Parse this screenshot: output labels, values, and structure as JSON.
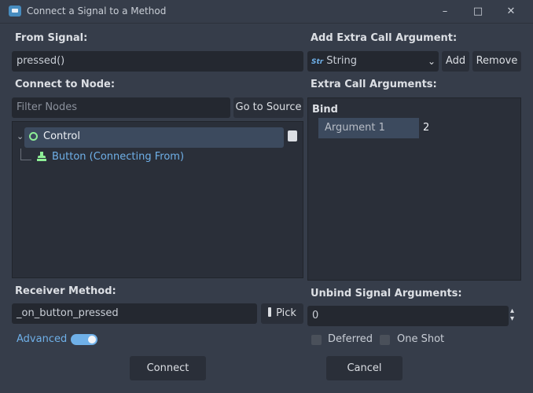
{
  "window": {
    "title": "Connect a Signal to a Method",
    "minimize": "–",
    "maximize": "□",
    "close": "✕"
  },
  "left": {
    "from_signal_label": "From Signal:",
    "from_signal_value": "pressed()",
    "connect_to_node_label": "Connect to Node:",
    "filter_placeholder": "Filter Nodes",
    "go_to_source": "Go to Source",
    "tree": {
      "root": "Control",
      "child": "Button (Connecting From)"
    },
    "receiver_method_label": "Receiver Method:",
    "receiver_method_value": "_on_button_pressed",
    "pick_button": "Pick",
    "advanced_label": "Advanced",
    "advanced_enabled": true
  },
  "right": {
    "add_extra_label": "Add Extra Call Argument:",
    "type_value": "String",
    "type_icon": "Str",
    "add_button": "Add",
    "remove_button": "Remove",
    "extra_args_label": "Extra Call Arguments:",
    "bind_header": "Bind",
    "arguments": [
      {
        "name": "Argument 1",
        "value": "2"
      }
    ],
    "unbind_label": "Unbind Signal Arguments:",
    "unbind_value": "0",
    "deferred_label": "Deferred",
    "one_shot_label": "One Shot"
  },
  "footer": {
    "connect": "Connect",
    "cancel": "Cancel"
  },
  "colors": {
    "bg": "#363d4a",
    "field": "#242830",
    "accent": "#6fb0e8",
    "node_green": "#8eef97",
    "link_blue": "#6fb0e8"
  }
}
